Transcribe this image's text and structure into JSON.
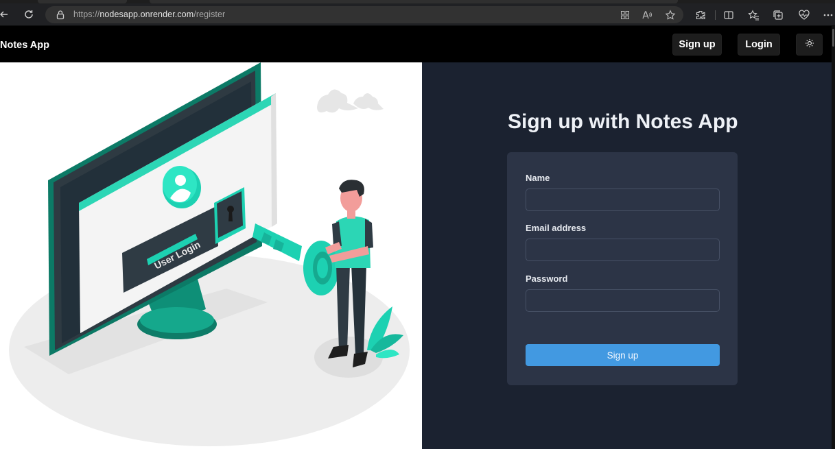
{
  "browser": {
    "url_prefix": "https://",
    "url_host": "nodesapp.onrender.com",
    "url_path": "/register",
    "toolbar_icons": [
      "back-icon",
      "reload-icon",
      "lock-icon",
      "apps-icon",
      "read-aloud-icon",
      "favorite-star-icon",
      "extensions-icon",
      "split-screen-icon",
      "favorites-icon",
      "collections-icon",
      "health-heart-icon",
      "more-icon"
    ]
  },
  "navbar": {
    "brand": "Notes App",
    "signup_label": "Sign up",
    "login_label": "Login",
    "theme_icon": "sun-icon"
  },
  "illustration": {
    "text": "User Login"
  },
  "form": {
    "heading": "Sign up with Notes App",
    "name_label": "Name",
    "email_label": "Email address",
    "password_label": "Password",
    "name_value": "",
    "email_value": "",
    "password_value": "",
    "submit_label": "Sign up"
  },
  "colors": {
    "panel_bg": "#1b2230",
    "card_bg": "#2c3446",
    "button_blue": "#4299e1",
    "accent_teal": "#1dd1b2",
    "navbar_bg": "#000000"
  }
}
